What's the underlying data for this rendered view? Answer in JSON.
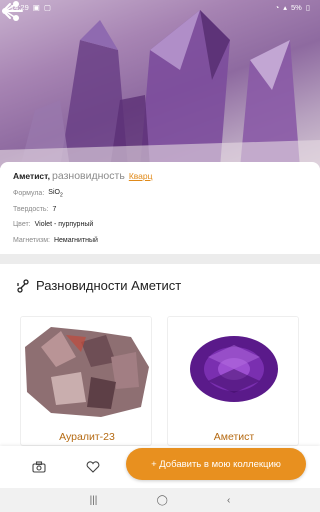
{
  "status_bar": {
    "time": "14:29",
    "battery": "5%"
  },
  "info": {
    "name": "Аметист,",
    "variety_text": "разновидность",
    "variety_link": "Кварц",
    "props": [
      {
        "label": "Формула:",
        "value": "SiO",
        "sub": "2"
      },
      {
        "label": "Твердость:",
        "value": "7"
      },
      {
        "label": "Цвет:",
        "value": "Violet - пурпурный"
      },
      {
        "label": "Магнетизм:",
        "value": "Немагнитный"
      }
    ]
  },
  "varieties": {
    "title": "Разновидности Аметист",
    "items": [
      {
        "label": "Ауралит-23"
      },
      {
        "label": "Аметист"
      }
    ]
  },
  "actions": {
    "add_label": "+ Добавить в мою коллекцию"
  },
  "colors": {
    "accent": "#e8901f",
    "link": "#e08a1a"
  }
}
